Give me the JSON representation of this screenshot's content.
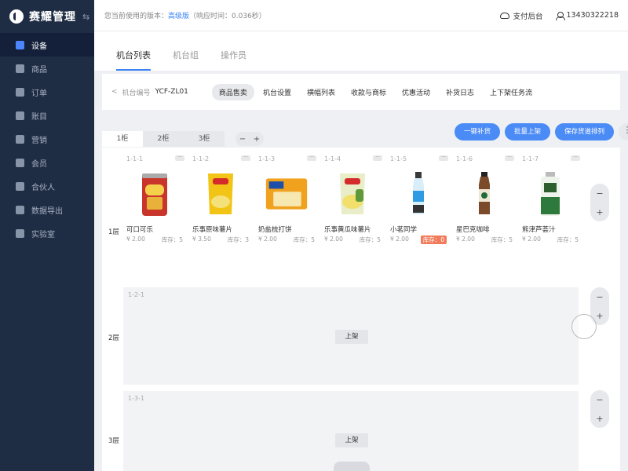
{
  "brand": {
    "name": "赛耀管理",
    "swap_icon": "⇆"
  },
  "sidebar": {
    "items": [
      {
        "label": "设备",
        "icon": "device-icon",
        "active": true
      },
      {
        "label": "商品",
        "icon": "goods-icon"
      },
      {
        "label": "订单",
        "icon": "order-icon"
      },
      {
        "label": "账目",
        "icon": "ledger-icon"
      },
      {
        "label": "营销",
        "icon": "marketing-icon"
      },
      {
        "label": "会员",
        "icon": "member-icon"
      },
      {
        "label": "合伙人",
        "icon": "partner-icon"
      },
      {
        "label": "数据导出",
        "icon": "export-icon"
      },
      {
        "label": "实验室",
        "icon": "lab-icon"
      }
    ]
  },
  "header": {
    "version_prefix": "您当前使用的版本：",
    "version": "高级版",
    "response": "（响应时间：0.036秒）",
    "pay_backend": "支付后台",
    "phone": "13430322218"
  },
  "tabs": [
    {
      "label": "机台列表",
      "active": true
    },
    {
      "label": "机台组"
    },
    {
      "label": "操作员"
    }
  ],
  "subnav": {
    "back": "<",
    "code_label": "机台编号",
    "code": "YCF-ZL01",
    "pills": [
      "商品售卖",
      "机台设置",
      "横幅列表",
      "收款与商标",
      "优惠活动",
      "补货日志",
      "上下架任务流"
    ],
    "active_pill": 0
  },
  "cabinets": [
    "1柜",
    "2柜",
    "3柜"
  ],
  "stepper": {
    "minus": "−",
    "plus": "+"
  },
  "actions": {
    "restock": "一键补货",
    "batch": "批量上架",
    "save": "保存货道排列",
    "more": "⋮"
  },
  "layers": [
    {
      "label": "1层",
      "slots": [
        {
          "id": "1-1-1",
          "name": "可口可乐",
          "price": "¥ 2.00",
          "stock": "库存：5",
          "img": "can"
        },
        {
          "id": "1-1-2",
          "name": "乐事原味薯片",
          "price": "¥ 3.50",
          "stock": "库存：3",
          "img": "chips-yellow"
        },
        {
          "id": "1-1-3",
          "name": "奶盐梳打饼",
          "price": "¥ 2.00",
          "stock": "库存：5",
          "img": "biscuit"
        },
        {
          "id": "1-1-4",
          "name": "乐事黄瓜味薯片",
          "price": "¥ 2.00",
          "stock": "库存：5",
          "img": "chips-green"
        },
        {
          "id": "1-1-5",
          "name": "小茗同学",
          "price": "¥ 2.00",
          "stock": "库存：0",
          "low": true,
          "img": "bottle-blue"
        },
        {
          "id": "1-1-6",
          "name": "星巴克咖啡",
          "price": "¥ 2.00",
          "stock": "库存：5",
          "img": "bottle-coffee"
        },
        {
          "id": "1-1-7",
          "name": "熊津芦荟汁",
          "price": "¥ 2.00",
          "stock": "库存：5",
          "img": "bottle-aloe"
        }
      ]
    },
    {
      "label": "2层",
      "slot_id": "1-2-1",
      "shelf_btn": "上架"
    },
    {
      "label": "3层",
      "slot_id": "1-3-1",
      "shelf_btn": "上架"
    }
  ],
  "colors": {
    "accent": "#4b8bf5",
    "sidebar": "#1f2d44",
    "low_stock": "#f07c5b"
  }
}
